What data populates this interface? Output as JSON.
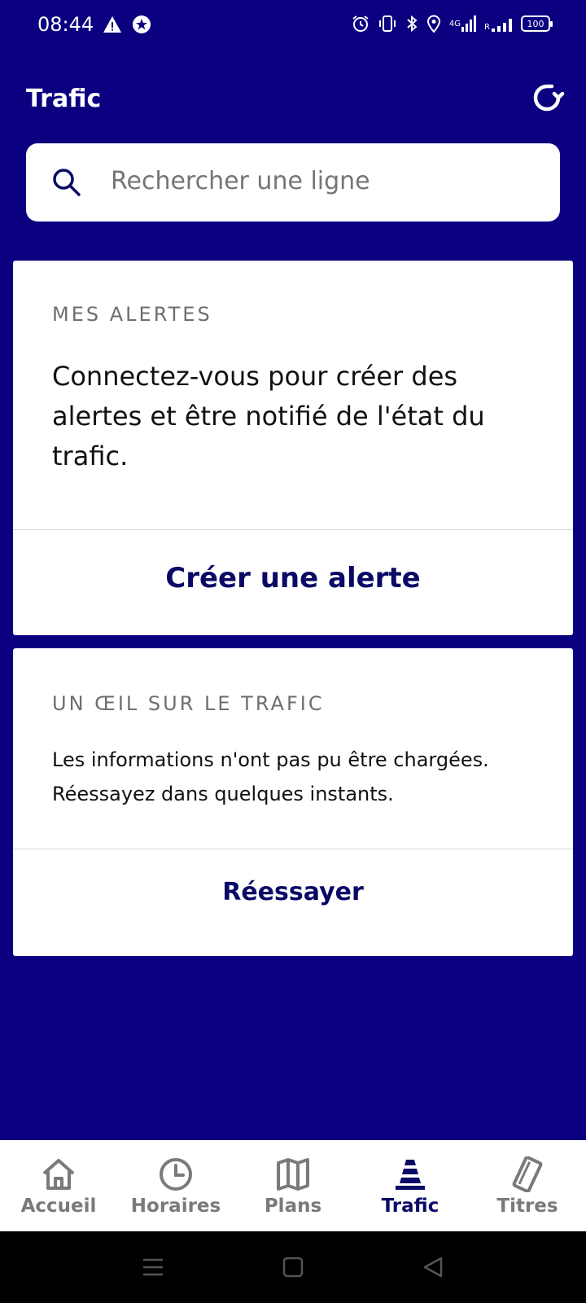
{
  "status_bar": {
    "time": "08:44",
    "network_label": "4G",
    "roaming_label": "R",
    "battery": "100",
    "icons_left": [
      "warning-icon",
      "star-badge-icon"
    ],
    "icons_right": [
      "alarm-icon",
      "vibrate-icon",
      "bluetooth-icon",
      "location-icon",
      "signal-icon",
      "signal-roaming-icon",
      "battery-icon"
    ]
  },
  "header": {
    "title": "Trafic",
    "refresh_icon": "refresh-icon"
  },
  "search": {
    "placeholder": "Rechercher une ligne",
    "icon": "search-icon"
  },
  "alerts_card": {
    "eyebrow": "MES ALERTES",
    "body": "Connectez-vous pour créer des alertes et être notifié de l'état du trafic.",
    "action": "Créer une alerte"
  },
  "traffic_card": {
    "eyebrow": "UN ŒIL SUR LE TRAFIC",
    "body": "Les informations n'ont pas pu être chargées. Réessayez dans quelques instants.",
    "action": "Réessayer"
  },
  "bottom_nav": {
    "items": [
      {
        "label": "Accueil",
        "icon": "home-icon",
        "active": false
      },
      {
        "label": "Horaires",
        "icon": "clock-icon",
        "active": false
      },
      {
        "label": "Plans",
        "icon": "map-icon",
        "active": false
      },
      {
        "label": "Trafic",
        "icon": "traffic-cone-icon",
        "active": true
      },
      {
        "label": "Titres",
        "icon": "ticket-icon",
        "active": false
      }
    ]
  },
  "colors": {
    "background": "#0a0080",
    "accent_text": "#0a0a66",
    "muted_text": "#757575"
  }
}
